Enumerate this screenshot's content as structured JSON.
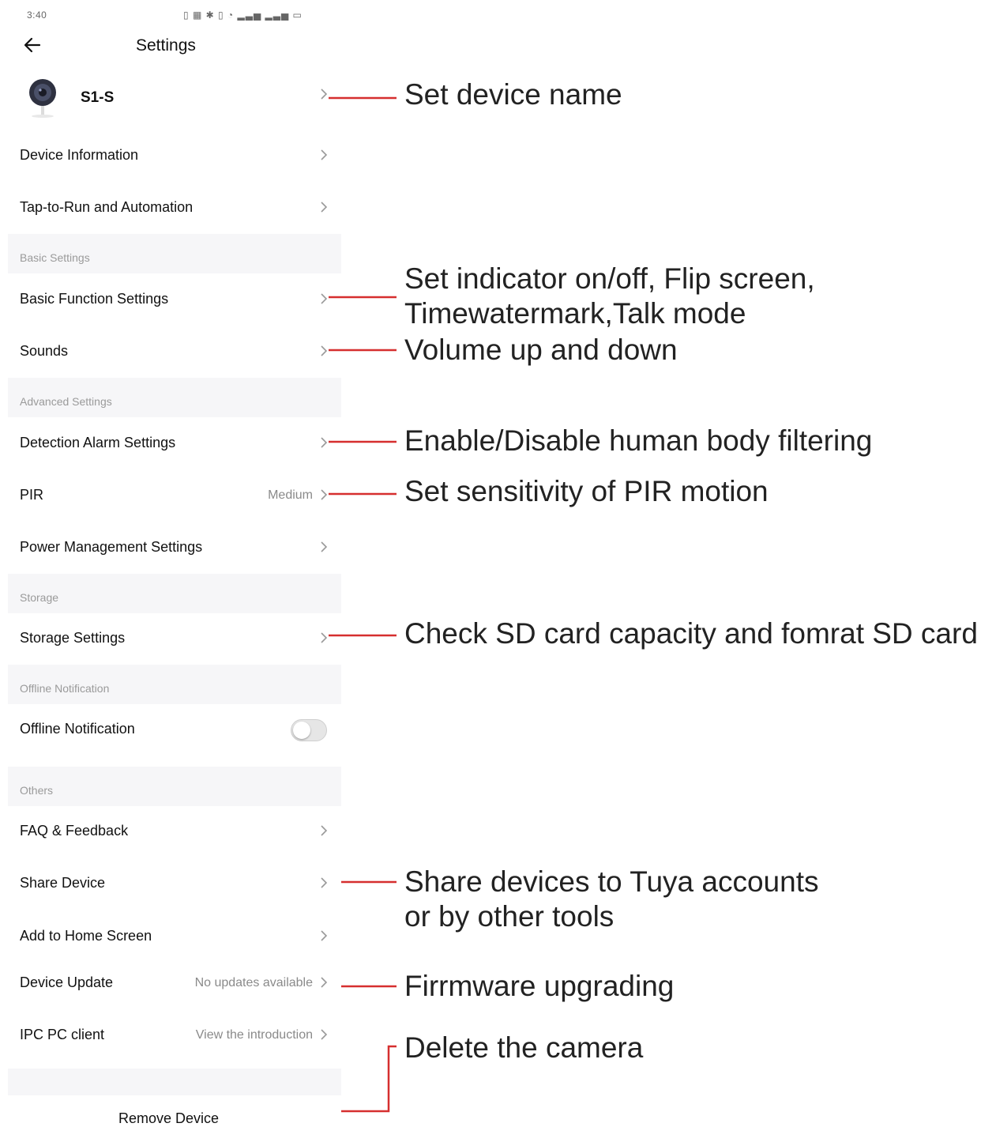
{
  "status_bar": {
    "time": "3:40",
    "icons": "signal-wifi-battery-icons"
  },
  "header": {
    "title": "Settings",
    "back_icon": "arrow-left-icon"
  },
  "device": {
    "name": "S1-S",
    "icon": "camera-icon"
  },
  "rows": {
    "device_information": "Device Information",
    "tap_to_run": "Tap-to-Run and Automation",
    "basic_function": "Basic Function Settings",
    "sounds": "Sounds",
    "detection_alarm": "Detection Alarm Settings",
    "pir": "PIR",
    "pir_value": "Medium",
    "power_management": "Power Management Settings",
    "storage_settings": "Storage Settings",
    "offline_notification": "Offline Notification",
    "faq": "FAQ & Feedback",
    "share_device": "Share Device",
    "add_home": "Add to Home Screen",
    "device_update": "Device Update",
    "device_update_value": "No updates available",
    "ipc_pc_client": "IPC PC client",
    "ipc_pc_client_value": "View the introduction"
  },
  "sections": {
    "basic": "Basic Settings",
    "advanced": "Advanced Settings",
    "storage": "Storage",
    "offline": "Offline Notification",
    "others": "Others"
  },
  "toggles": {
    "offline_notification_on": false
  },
  "remove_label": "Remove Device",
  "annotations": {
    "device_name": "Set device name",
    "basic_1": "Set indicator on/off, Flip screen,",
    "basic_2": "Timewatermark,Talk mode",
    "sounds": "Volume up and down",
    "detection": "Enable/Disable human body filtering",
    "pir": "Set sensitivity of PIR motion",
    "storage": "Check SD card capacity and fomrat SD card",
    "share_1": "Share devices to Tuya accounts",
    "share_2": "or by other tools",
    "update": "Firrmware upgrading",
    "remove": "Delete the camera"
  },
  "colors": {
    "annotation_line": "#d62f2f",
    "muted_text": "#9a9a9a",
    "section_bg": "#f6f6f8"
  }
}
